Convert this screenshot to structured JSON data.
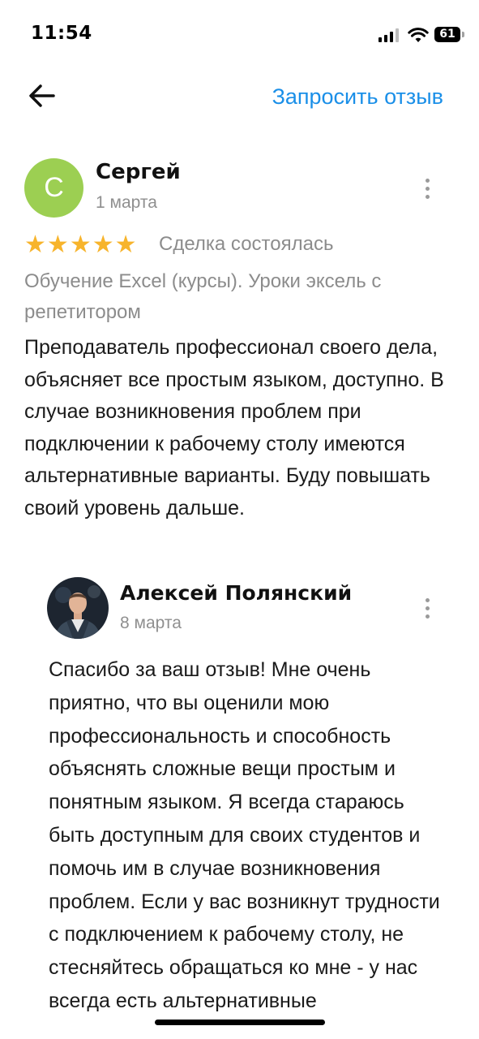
{
  "status_bar": {
    "time": "11:54",
    "battery": "61",
    "icons": [
      "signal-icon",
      "wifi-icon",
      "battery-icon"
    ]
  },
  "header": {
    "back_icon": "arrow-left-icon",
    "request_review_label": "Запросить отзыв",
    "accent_color": "#1a8fe8"
  },
  "review": {
    "avatar_letter": "С",
    "avatar_color": "#9ccf52",
    "author": "Сергей",
    "date": "1 марта",
    "rating": 5,
    "rating_max": 5,
    "star_color": "#f7b42c",
    "status": "Сделка состоялась",
    "service": "Обучение Excel (курсы). Уроки эксель с репетитором",
    "text": "Преподаватель профессионал своего дела, объясняет все простым языком, доступно. В случае возникновения проблем при подключении к рабочему столу имеются альтернативные варианты. Буду повышать своий уровень дальше."
  },
  "reply": {
    "author": "Алексей Полянский",
    "date": "8 марта",
    "text": "Спасибо за ваш отзыв! Мне очень приятно, что вы оценили мою профессиональность и способность объяснять сложные вещи простым и понятным языком. Я всегда стараюсь быть доступным для своих студентов и помочь им в случае возникновения проблем. Если у вас возникнут трудности с подключением к рабочему столу, не стесняйтесь обращаться ко мне - у нас всегда есть альтернативные"
  }
}
